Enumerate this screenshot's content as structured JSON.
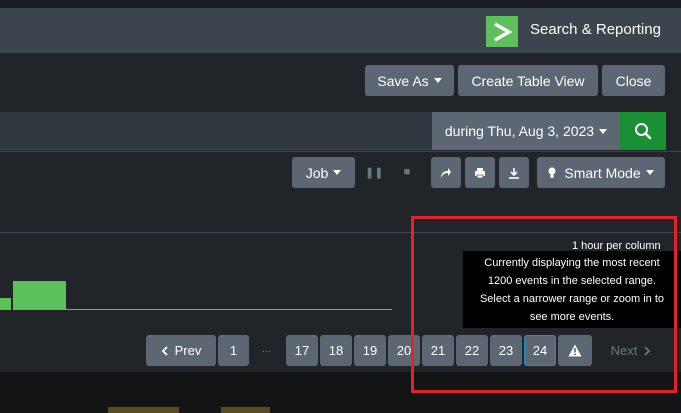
{
  "app": {
    "title": "Search & Reporting",
    "logo_glyph": ">"
  },
  "toolbar": {
    "save_as": "Save As",
    "create_table_view": "Create Table View",
    "close": "Close"
  },
  "search": {
    "time_range": "during Thu, Aug 3, 2023"
  },
  "job_controls": {
    "job": "Job",
    "smart_mode": "Smart Mode"
  },
  "timeline": {
    "per_column": "1 hour per column",
    "bar_color": "#5cc05c"
  },
  "tooltip": {
    "lines": [
      "Currently displaying the most recent",
      "1200 events in the selected range.",
      "Select a narrower range or zoom in to",
      "see more events."
    ]
  },
  "pagination": {
    "prev": "Prev",
    "first": "1",
    "ellipsis": "...",
    "pages": [
      "17",
      "18",
      "19",
      "20",
      "21",
      "22",
      "23",
      "24"
    ],
    "current": "24",
    "next": "Next"
  },
  "colors": {
    "accent_green": "#1a9035",
    "highlight_red": "#e5212a",
    "current_page_border": "#1e93c6"
  }
}
